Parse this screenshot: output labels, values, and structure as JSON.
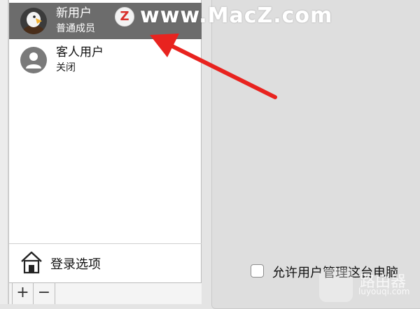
{
  "users": {
    "current": {
      "name": "新用户",
      "role": "普通成员",
      "avatar_icon": "eagle-avatar-icon"
    },
    "guest": {
      "name": "客人用户",
      "status": "关闭",
      "avatar_icon": "person-icon"
    }
  },
  "login_options": {
    "label": "登录选项",
    "icon": "house-icon"
  },
  "toolbar": {
    "add_label": "+",
    "remove_label": "−"
  },
  "allow_admin": {
    "label": "允许用户管理这台电脑",
    "checked": false
  },
  "watermark": {
    "logo_letter": "Z",
    "text": "www.MacZ.com"
  },
  "corner_watermark": {
    "text": "路由器",
    "sub": "luyouqi.com"
  },
  "colors": {
    "selected_row": "#6c6c6c",
    "arrow": "#e8231f"
  }
}
